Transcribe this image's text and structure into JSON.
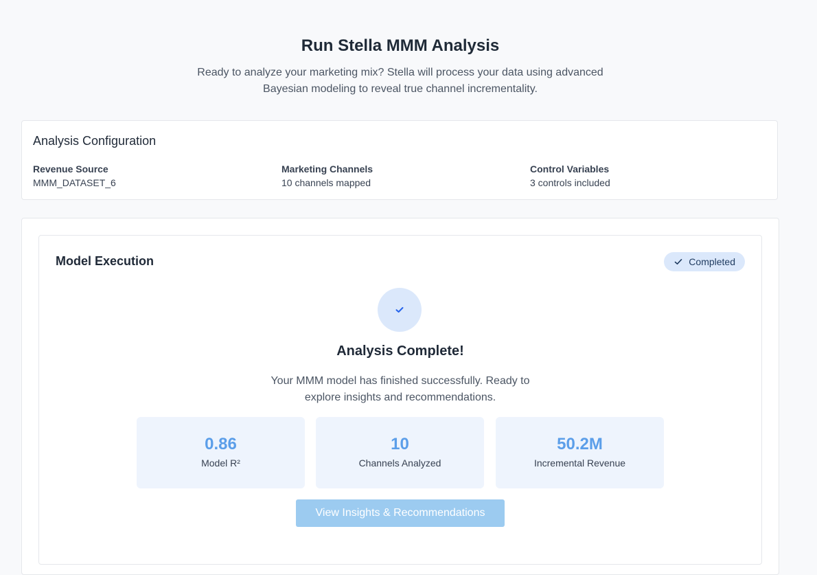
{
  "header": {
    "title": "Run Stella MMM Analysis",
    "subtitle": "Ready to analyze your marketing mix? Stella will process your data using advanced Bayesian modeling to reveal true channel incrementality."
  },
  "config": {
    "title": "Analysis Configuration",
    "items": [
      {
        "label": "Revenue Source",
        "value": "MMM_DATASET_6"
      },
      {
        "label": "Marketing Channels",
        "value": "10 channels mapped"
      },
      {
        "label": "Control Variables",
        "value": "3 controls included"
      }
    ]
  },
  "execution": {
    "title": "Model Execution",
    "status": "Completed",
    "status_icon": "check-icon",
    "complete_title": "Analysis Complete!",
    "complete_description": "Your MMM model has finished successfully. Ready to explore insights and recommendations.",
    "metrics": [
      {
        "value": "0.86",
        "label": "Model R²"
      },
      {
        "value": "10",
        "label": "Channels Analyzed"
      },
      {
        "value": "50.2M",
        "label": "Incremental Revenue"
      }
    ],
    "cta_label": "View Insights & Recommendations"
  },
  "colors": {
    "accent": "#5b9ee9",
    "badge_bg": "#dbe8fb",
    "metric_bg": "#eef4fd",
    "button_bg": "#9ccbf0"
  }
}
